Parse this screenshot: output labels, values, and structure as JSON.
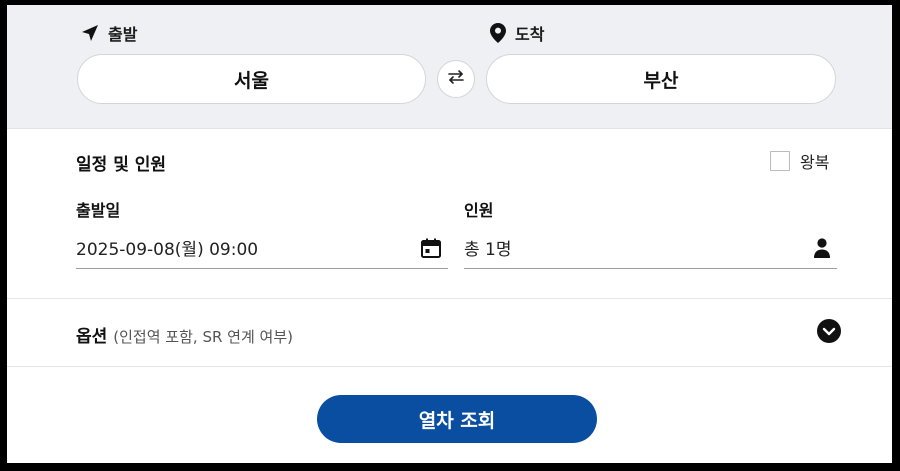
{
  "route": {
    "departure_label": "출발",
    "arrival_label": "도착",
    "departure_station": "서울",
    "arrival_station": "부산"
  },
  "schedule": {
    "section_title": "일정 및 인원",
    "roundtrip_label": "왕복",
    "roundtrip_checked": false,
    "date_label": "출발일",
    "date_value": "2025-09-08(월) 09:00",
    "passenger_label": "인원",
    "passenger_value": "총 1명"
  },
  "options": {
    "title": "옵션",
    "subtitle": "(인접역 포함, SR 연계 여부)"
  },
  "search_button_label": "열차 조회",
  "colors": {
    "primary": "#0a4ea2",
    "route_background": "#eef0f3"
  },
  "icons": {
    "departure": "navigation-arrow-icon",
    "arrival": "location-pin-icon",
    "swap": "swap-arrows-icon",
    "calendar": "calendar-icon",
    "person": "person-icon",
    "expand": "chevron-down-circle-icon"
  }
}
